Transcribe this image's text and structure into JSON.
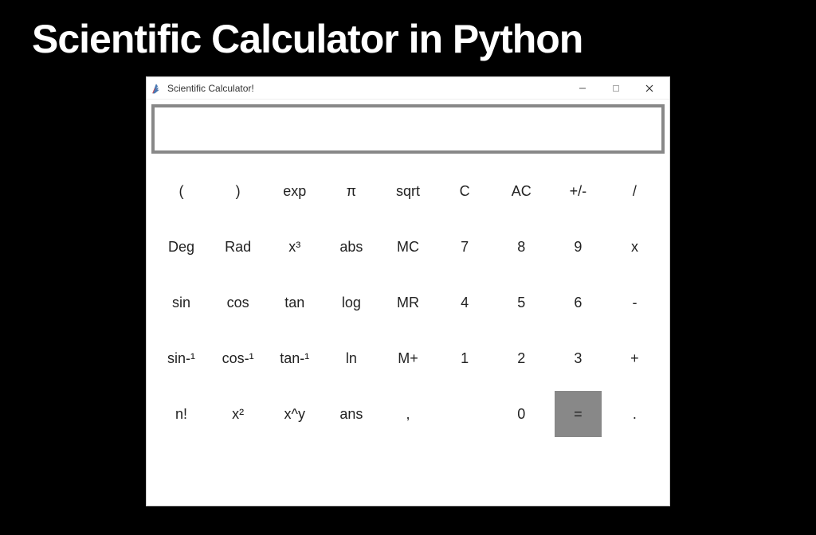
{
  "heading": "Scientific Calculator in Python",
  "window": {
    "title": "Scientific Calculator!"
  },
  "display": {
    "value": ""
  },
  "buttons": {
    "r1c1": "(",
    "r1c2": ")",
    "r1c3": "exp",
    "r1c4": "π",
    "r1c5": "sqrt",
    "r1c6": "C",
    "r1c7": "AC",
    "r1c8": "+/-",
    "r1c9": "/",
    "r2c1": "Deg",
    "r2c2": "Rad",
    "r2c3": "x³",
    "r2c4": "abs",
    "r2c5": "MC",
    "r2c6": "7",
    "r2c7": "8",
    "r2c8": "9",
    "r2c9": "x",
    "r3c1": "sin",
    "r3c2": "cos",
    "r3c3": "tan",
    "r3c4": "log",
    "r3c5": "MR",
    "r3c6": "4",
    "r3c7": "5",
    "r3c8": "6",
    "r3c9": "-",
    "r4c1": "sin-¹",
    "r4c2": "cos-¹",
    "r4c3": "tan-¹",
    "r4c4": "ln",
    "r4c5": "M+",
    "r4c6": "1",
    "r4c7": "2",
    "r4c8": "3",
    "r4c9": "+",
    "r5c1": "n!",
    "r5c2": "x²",
    "r5c3": "x^y",
    "r5c4": "ans",
    "r5c5": ",",
    "r5c6": "",
    "r5c7": "0",
    "r5c8": "=",
    "r5c9": "."
  }
}
